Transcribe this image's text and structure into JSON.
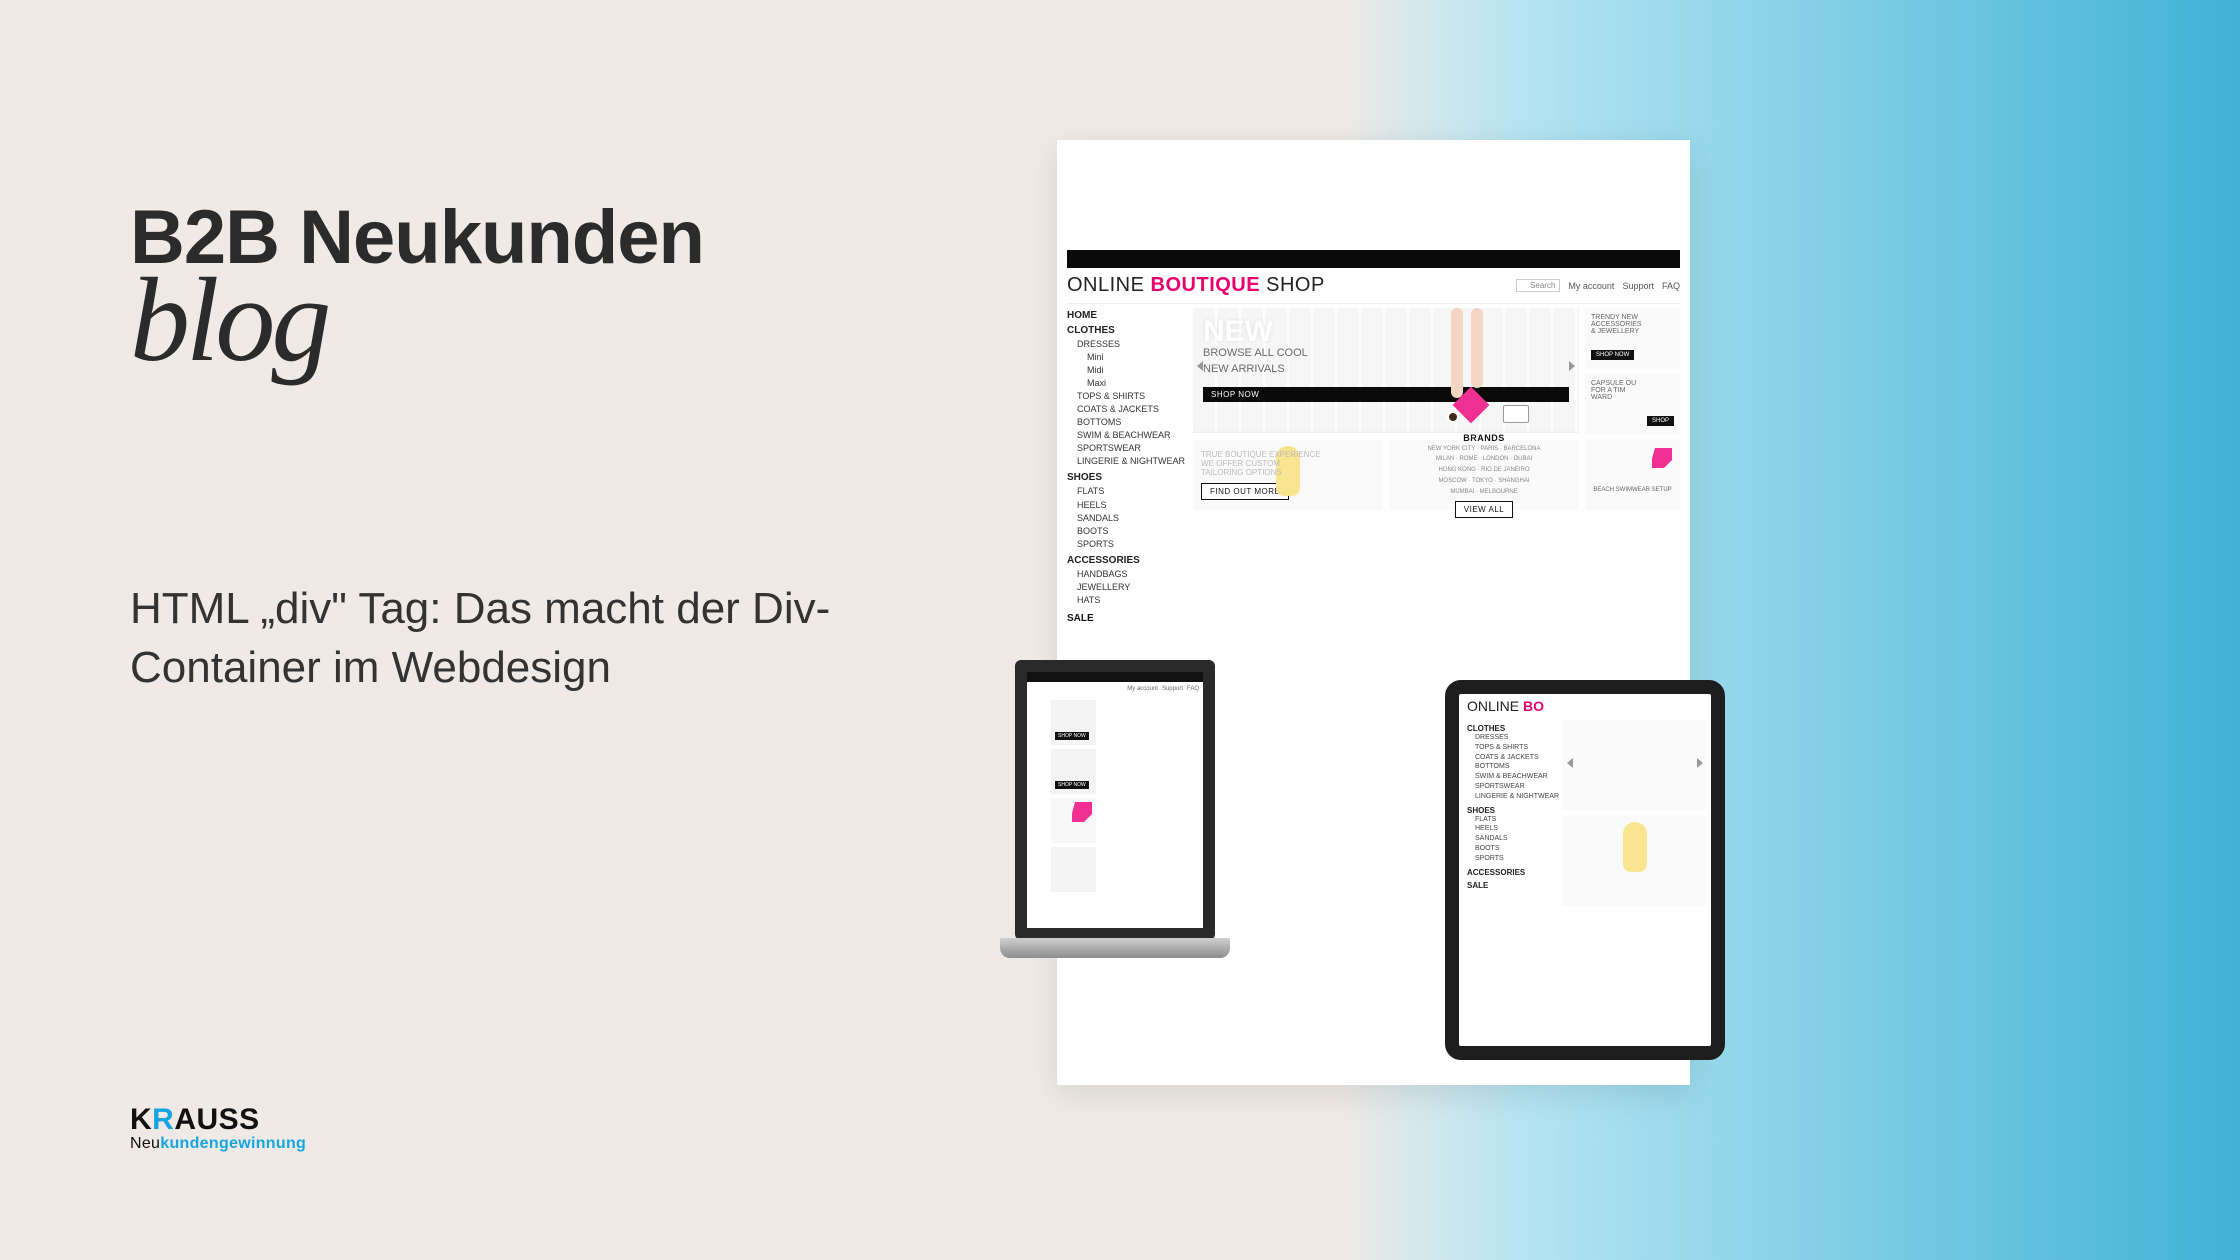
{
  "header": {
    "title": "B2B Neukunden",
    "blog_word": "blog"
  },
  "article": {
    "title": "HTML „div\" Tag: Das macht der Div-Container im Webdesign"
  },
  "logo": {
    "pre": "K",
    "r": "R",
    "post": "AUSS",
    "sub_pre": "Neu",
    "sub_accent": "kundengewinnung"
  },
  "shop": {
    "brand_pre": "ONLINE ",
    "brand_mid": "BOUTIQUE",
    "brand_post": " SHOP",
    "search_placeholder": "Search",
    "util": {
      "account": "My account",
      "support": "Support",
      "faq": "FAQ"
    },
    "nav": {
      "home": "HOME",
      "clothes": {
        "label": "CLOTHES",
        "items": [
          "DRESSES",
          "Mini",
          "Midi",
          "Maxi",
          "TOPS & SHIRTS",
          "COATS & JACKETS",
          "BOTTOMS",
          "SWIM & BEACHWEAR",
          "SPORTSWEAR",
          "LINGERIE & NIGHTWEAR"
        ]
      },
      "shoes": {
        "label": "SHOES",
        "items": [
          "FLATS",
          "HEELS",
          "SANDALS",
          "BOOTS",
          "SPORTS"
        ]
      },
      "accessories": {
        "label": "ACCESSORIES",
        "items": [
          "HANDBAGS",
          "JEWELLERY",
          "HATS"
        ]
      },
      "sale": "SALE"
    },
    "hero": {
      "headline": "NEW",
      "sub_l1": "BROWSE ALL COOL",
      "sub_l2": "NEW ARRIVALS",
      "cta": "SHOP NOW"
    },
    "side_trendy": {
      "l1": "TRENDY NEW",
      "l2": "ACCESSORIES",
      "l3": "& JEWELLERY",
      "cta": "SHOP NOW"
    },
    "side_capsule": {
      "l1": "CAPSULE OU",
      "l2": "FOR A TIM",
      "l3": "WARD",
      "cta": "SHOP"
    },
    "boutique_tile": {
      "l1": "TRUE BOUTIQUE EXPERIENCE",
      "l2": "WE OFFER CUSTOM",
      "l3": "TAILORING OPTIONS",
      "cta": "FIND OUT MORE"
    },
    "brands_tile": {
      "hd": "BRANDS",
      "row1": "NEW YORK CITY · PARIS · BARCELONA",
      "row2": "MILAN · ROME · LONDON · DUBAI",
      "row3": "HONG KONG · RIO DE JANEIRO",
      "row4": "MOSCOW · TOKYO · SHANGHAI",
      "row5": "MUMBAI · MELBOURNE",
      "cta": "VIEW ALL"
    },
    "beach_tile": {
      "l1": "BEACH SWIMWEAR SETUP"
    }
  },
  "laptop": {
    "top": {
      "account": "My account",
      "support": "Support",
      "faq": "FAQ"
    },
    "cta": "SHOP NOW"
  },
  "tablet": {
    "brand_pre": "ONLINE ",
    "brand_mid": "BO",
    "nav": {
      "clothes": {
        "label": "CLOTHES",
        "items": [
          "DRESSES",
          "TOPS & SHIRTS",
          "COATS & JACKETS",
          "BOTTOMS",
          "SWIM & BEACHWEAR",
          "SPORTSWEAR",
          "LINGERIE & NIGHTWEAR"
        ]
      },
      "shoes": {
        "label": "SHOES",
        "items": [
          "FLATS",
          "HEELS",
          "SANDALS",
          "BOOTS",
          "SPORTS"
        ]
      },
      "accessories": {
        "label": "ACCESSORIES"
      },
      "sale": "SALE"
    }
  }
}
